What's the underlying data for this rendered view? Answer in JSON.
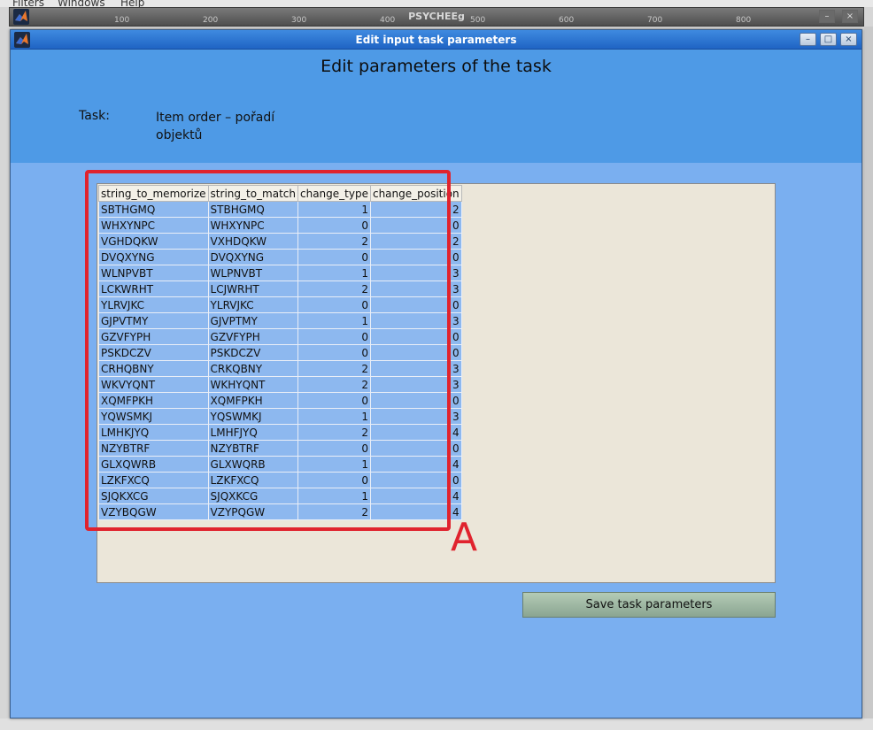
{
  "background_app": {
    "menu": [
      "Filters",
      "Windows",
      "Help"
    ],
    "title": "PSYCHEEg",
    "ticks": [
      "100",
      "200",
      "300",
      "400",
      "500",
      "600",
      "700",
      "800"
    ]
  },
  "dialog": {
    "title": "Edit input task parameters",
    "heading": "Edit parameters of the task",
    "task_label": "Task:",
    "task_value": "Item order – pořadí objektů",
    "window_buttons": [
      "–",
      "□",
      "×"
    ]
  },
  "table": {
    "columns": [
      "string_to_memorize",
      "string_to_match",
      "change_type",
      "change_position"
    ],
    "rows": [
      [
        "SBTHGMQ",
        "STBHGMQ",
        "1",
        "2"
      ],
      [
        "WHXYNPC",
        "WHXYNPC",
        "0",
        "0"
      ],
      [
        "VGHDQKW",
        "VXHDQKW",
        "2",
        "2"
      ],
      [
        "DVQXYNG",
        "DVQXYNG",
        "0",
        "0"
      ],
      [
        "WLNPVBT",
        "WLPNVBT",
        "1",
        "3"
      ],
      [
        "LCKWRHT",
        "LCJWRHT",
        "2",
        "3"
      ],
      [
        "YLRVJKC",
        "YLRVJKC",
        "0",
        "0"
      ],
      [
        "GJPVTMY",
        "GJVPTMY",
        "1",
        "3"
      ],
      [
        "GZVFYPH",
        "GZVFYPH",
        "0",
        "0"
      ],
      [
        "PSKDCZV",
        "PSKDCZV",
        "0",
        "0"
      ],
      [
        "CRHQBNY",
        "CRKQBNY",
        "2",
        "3"
      ],
      [
        "WKVYQNT",
        "WKHYQNT",
        "2",
        "3"
      ],
      [
        "XQMFPKH",
        "XQMFPKH",
        "0",
        "0"
      ],
      [
        "YQWSMKJ",
        "YQSWMKJ",
        "1",
        "3"
      ],
      [
        "LMHKJYQ",
        "LMHFJYQ",
        "2",
        "4"
      ],
      [
        "NZYBTRF",
        "NZYBTRF",
        "0",
        "0"
      ],
      [
        "GLXQWRB",
        "GLXWQRB",
        "1",
        "4"
      ],
      [
        "LZKFXCQ",
        "LZKFXCQ",
        "0",
        "0"
      ],
      [
        "SJQKXCG",
        "SJQXKCG",
        "1",
        "4"
      ],
      [
        "VZYBQGW",
        "VZYPQGW",
        "2",
        "4"
      ]
    ]
  },
  "annotation": {
    "label": "A",
    "color": "#e0232e"
  },
  "save_button_label": "Save task parameters",
  "colors": {
    "dialog_bg": "#7aaff0",
    "header_band": "#4e9ae6",
    "titlebar": "#1f64c4",
    "cell_bg": "#8db8ef",
    "panel_bg": "#ebe6d9"
  }
}
